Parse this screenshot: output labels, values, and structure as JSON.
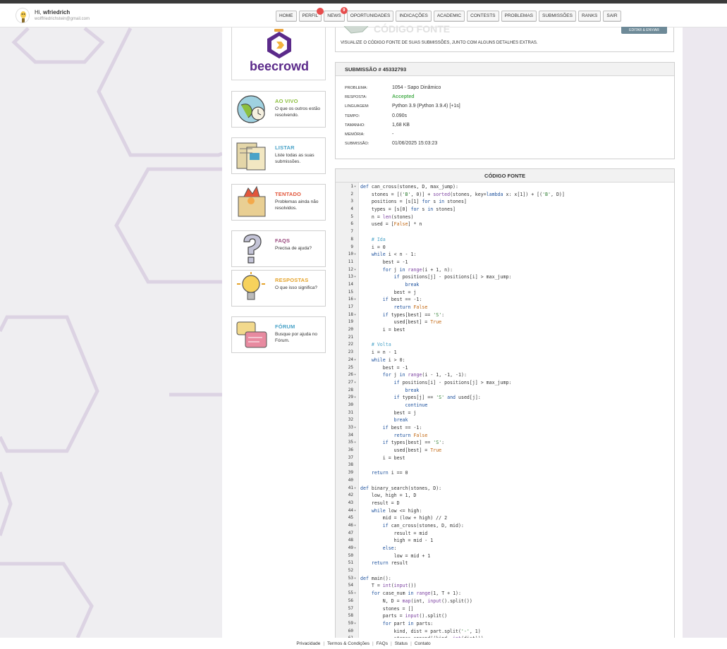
{
  "user": {
    "greeting": "Hi,",
    "name": "wfriedrich",
    "email": "wolffriedrichstein@gmail.com"
  },
  "nav": [
    {
      "label": "HOME"
    },
    {
      "label": "PERFIL",
      "dot": true
    },
    {
      "label": "NEWS",
      "badge": "9"
    },
    {
      "label": "OPORTUNIDADES"
    },
    {
      "label": "INDICAÇÕES"
    },
    {
      "label": "ACADEMIC"
    },
    {
      "label": "CONTESTS"
    },
    {
      "label": "PROBLEMAS"
    },
    {
      "label": "SUBMISSÕES"
    },
    {
      "label": "RANKS"
    },
    {
      "label": "SAIR"
    }
  ],
  "logo": {
    "text": "beecrowd"
  },
  "side_cards": [
    {
      "title": "AO VIVO",
      "desc": "O que os outros estão resolvendo.",
      "color": "#8cbf3f",
      "icon": "globe-icon"
    },
    {
      "title": "LISTAR",
      "desc": "Liste todas as suas submissões.",
      "color": "#4aa3c8",
      "icon": "list-icon"
    },
    {
      "title": "TENTADO",
      "desc": "Problemas ainda não resolvidos.",
      "color": "#e2563b",
      "icon": "attempted-icon"
    },
    {
      "title": "FAQS",
      "desc": "Precisa de ajuda?",
      "color": "#9b4a7f",
      "icon": "question-icon"
    },
    {
      "title": "RESPOSTAS",
      "desc": "O que isso significa?",
      "color": "#e5a42c",
      "icon": "lightbulb-icon"
    },
    {
      "title": "FÓRUM",
      "desc": "Busque por ajuda no Fórum.",
      "color": "#4aa3c8",
      "icon": "forum-icon"
    }
  ],
  "header": {
    "title": "CÓDIGO FONTE",
    "description": "VISUALIZE O CÓDIGO FONTE DE SUAS SUBMISSÕES, JUNTO COM ALGUNS DETALHES EXTRAS.",
    "button": "EDITAR & ENVIAR"
  },
  "submission": {
    "heading": "SUBMISSÃO # 45332793",
    "rows": [
      {
        "k": "PROBLEMA:",
        "v": "1054 - Sapo Dinâmico"
      },
      {
        "k": "RESPOSTA:",
        "v": "Accepted",
        "accent": true
      },
      {
        "k": "LINGUAGEM:",
        "v": "Python 3.9 (Python 3.9.4) [+1s]"
      },
      {
        "k": "TEMPO:",
        "v": "0.090s"
      },
      {
        "k": "TAMANHO:",
        "v": "1,68 KB"
      },
      {
        "k": "MEMÓRIA:",
        "v": "-"
      },
      {
        "k": "SUBMISSÃO:",
        "v": "01/06/2025 15:03:23"
      }
    ],
    "accepted_color": "#4caf50"
  },
  "code_heading": "CÓDIGO FONTE",
  "code_lines": [
    "def can_cross(stones, D, max_jump):",
    "    stones = [('B', 0)] + sorted(stones, key=lambda x: x[1]) + [('B', D)]",
    "    positions = [s[1] for s in stones]",
    "    types = [s[0] for s in stones]",
    "    n = len(stones)",
    "    used = [False] * n",
    "",
    "    # Ida",
    "    i = 0",
    "    while i < n - 1:",
    "        best = -1",
    "        for j in range(i + 1, n):",
    "            if positions[j] - positions[i] > max_jump:",
    "                break",
    "            best = j",
    "        if best == -1:",
    "            return False",
    "        if types[best] == 'S':",
    "            used[best] = True",
    "        i = best",
    "",
    "    # Volta",
    "    i = n - 1",
    "    while i > 0:",
    "        best = -1",
    "        for j in range(i - 1, -1, -1):",
    "            if positions[i] - positions[j] > max_jump:",
    "                break",
    "            if types[j] == 'S' and used[j]:",
    "                continue",
    "            best = j",
    "            break",
    "        if best == -1:",
    "            return False",
    "        if types[best] == 'S':",
    "            used[best] = True",
    "        i = best",
    "",
    "    return i == 0",
    "",
    "def binary_search(stones, D):",
    "    low, high = 1, D",
    "    result = D",
    "    while low <= high:",
    "        mid = (low + high) // 2",
    "        if can_cross(stones, D, mid):",
    "            result = mid",
    "            high = mid - 1",
    "        else:",
    "            low = mid + 1",
    "    return result",
    "",
    "def main():",
    "    T = int(input())",
    "    for case_num in range(1, T + 1):",
    "        N, D = map(int, input().split())",
    "        stones = []",
    "        parts = input().split()",
    "        for part in parts:",
    "            kind, dist = part.split('-', 1)",
    "            stones.append((kind, int(dist)))"
  ],
  "folds": [
    1,
    10,
    12,
    13,
    16,
    18,
    24,
    26,
    27,
    29,
    33,
    35,
    41,
    44,
    46,
    49,
    53,
    55,
    59
  ],
  "footer": [
    "Privacidade",
    "Termos & Condições",
    "FAQs",
    "Status",
    "Contato"
  ]
}
